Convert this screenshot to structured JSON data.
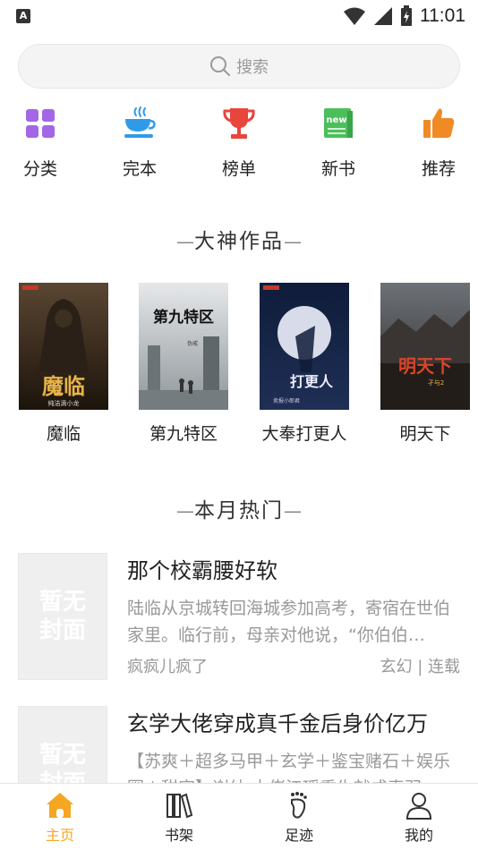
{
  "status_bar": {
    "time": "11:01",
    "left_icon": "A"
  },
  "search": {
    "placeholder": "搜索"
  },
  "categories": [
    {
      "label": "分类",
      "icon": "grid-icon",
      "color": "#a366e6"
    },
    {
      "label": "完本",
      "icon": "coffee-cup-icon",
      "color": "#2f9be8"
    },
    {
      "label": "榜单",
      "icon": "trophy-icon",
      "color": "#e8453c"
    },
    {
      "label": "新书",
      "icon": "new-book-icon",
      "color": "#4bbf5a"
    },
    {
      "label": "推荐",
      "icon": "thumbs-up-icon",
      "color": "#f08a24"
    }
  ],
  "sections": {
    "featured_title": "大神作品",
    "hot_title": "本月热门"
  },
  "featured_books": [
    {
      "title": "魔临",
      "cover_text": "魔临",
      "cover_sub": "纯洁滴小龙"
    },
    {
      "title": "第九特区",
      "cover_text": "第九特区",
      "cover_sub": "伪戒"
    },
    {
      "title": "大奉打更人",
      "cover_text": "打更人",
      "cover_sub": "卖报小郎君"
    },
    {
      "title": "明天下",
      "cover_text": "明天下",
      "cover_sub": "孑与2"
    }
  ],
  "hot_books": [
    {
      "title": "那个校霸腰好软",
      "description": "陆临从京城转回海城参加高考，寄宿在世伯家里。临行前，母亲对他说，“你伯伯…",
      "author": "疯疯儿疯了",
      "genre": "玄幻",
      "status": "连载",
      "thumb_text": "暂无封面"
    },
    {
      "title": "玄学大佬穿成真千金后身价亿万",
      "description": "【苏爽＋超多马甲＋玄学＋鉴宝赌石＋娱乐圈＋甜宠】谢幼 大佬江瑶重生就成真羽",
      "author": "",
      "genre": "",
      "status": "",
      "thumb_text": "暂无封面"
    }
  ],
  "bottom_nav": [
    {
      "label": "主页",
      "icon": "home-icon",
      "active": true
    },
    {
      "label": "书架",
      "icon": "bookshelf-icon",
      "active": false
    },
    {
      "label": "足迹",
      "icon": "footprint-icon",
      "active": false
    },
    {
      "label": "我的",
      "icon": "user-icon",
      "active": false
    }
  ],
  "colors": {
    "accent": "#f5a623",
    "text_primary": "#222222",
    "text_secondary": "#999999"
  }
}
